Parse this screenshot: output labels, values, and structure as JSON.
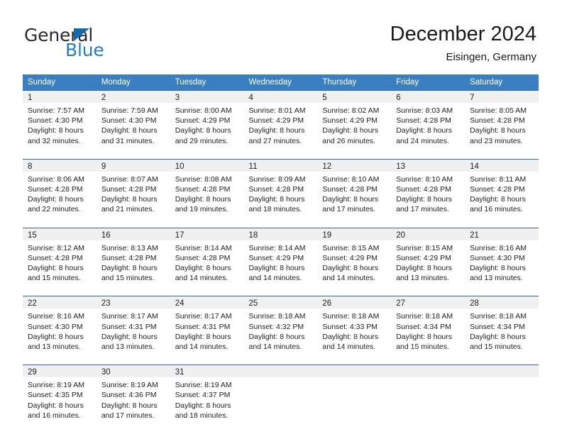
{
  "brand": {
    "name_part1": "General",
    "name_part2": "Blue",
    "triangle_color": "#1269b0",
    "blue_color": "#1f7ec4"
  },
  "header": {
    "title": "December 2024",
    "subtitle": "Eisingen, Germany"
  },
  "theme": {
    "header_row_bg": "#3a7fc1",
    "week_rule": "#2b6cab",
    "daynum_bg": "#f0f0f0",
    "text": "#222222"
  },
  "weekdays": [
    "Sunday",
    "Monday",
    "Tuesday",
    "Wednesday",
    "Thursday",
    "Friday",
    "Saturday"
  ],
  "weeks": [
    [
      {
        "day": "1",
        "sunrise": "Sunrise: 7:57 AM",
        "sunset": "Sunset: 4:30 PM",
        "daylight1": "Daylight: 8 hours",
        "daylight2": "and 32 minutes."
      },
      {
        "day": "2",
        "sunrise": "Sunrise: 7:59 AM",
        "sunset": "Sunset: 4:30 PM",
        "daylight1": "Daylight: 8 hours",
        "daylight2": "and 31 minutes."
      },
      {
        "day": "3",
        "sunrise": "Sunrise: 8:00 AM",
        "sunset": "Sunset: 4:29 PM",
        "daylight1": "Daylight: 8 hours",
        "daylight2": "and 29 minutes."
      },
      {
        "day": "4",
        "sunrise": "Sunrise: 8:01 AM",
        "sunset": "Sunset: 4:29 PM",
        "daylight1": "Daylight: 8 hours",
        "daylight2": "and 27 minutes."
      },
      {
        "day": "5",
        "sunrise": "Sunrise: 8:02 AM",
        "sunset": "Sunset: 4:29 PM",
        "daylight1": "Daylight: 8 hours",
        "daylight2": "and 26 minutes."
      },
      {
        "day": "6",
        "sunrise": "Sunrise: 8:03 AM",
        "sunset": "Sunset: 4:28 PM",
        "daylight1": "Daylight: 8 hours",
        "daylight2": "and 24 minutes."
      },
      {
        "day": "7",
        "sunrise": "Sunrise: 8:05 AM",
        "sunset": "Sunset: 4:28 PM",
        "daylight1": "Daylight: 8 hours",
        "daylight2": "and 23 minutes."
      }
    ],
    [
      {
        "day": "8",
        "sunrise": "Sunrise: 8:06 AM",
        "sunset": "Sunset: 4:28 PM",
        "daylight1": "Daylight: 8 hours",
        "daylight2": "and 22 minutes."
      },
      {
        "day": "9",
        "sunrise": "Sunrise: 8:07 AM",
        "sunset": "Sunset: 4:28 PM",
        "daylight1": "Daylight: 8 hours",
        "daylight2": "and 21 minutes."
      },
      {
        "day": "10",
        "sunrise": "Sunrise: 8:08 AM",
        "sunset": "Sunset: 4:28 PM",
        "daylight1": "Daylight: 8 hours",
        "daylight2": "and 19 minutes."
      },
      {
        "day": "11",
        "sunrise": "Sunrise: 8:09 AM",
        "sunset": "Sunset: 4:28 PM",
        "daylight1": "Daylight: 8 hours",
        "daylight2": "and 18 minutes."
      },
      {
        "day": "12",
        "sunrise": "Sunrise: 8:10 AM",
        "sunset": "Sunset: 4:28 PM",
        "daylight1": "Daylight: 8 hours",
        "daylight2": "and 17 minutes."
      },
      {
        "day": "13",
        "sunrise": "Sunrise: 8:10 AM",
        "sunset": "Sunset: 4:28 PM",
        "daylight1": "Daylight: 8 hours",
        "daylight2": "and 17 minutes."
      },
      {
        "day": "14",
        "sunrise": "Sunrise: 8:11 AM",
        "sunset": "Sunset: 4:28 PM",
        "daylight1": "Daylight: 8 hours",
        "daylight2": "and 16 minutes."
      }
    ],
    [
      {
        "day": "15",
        "sunrise": "Sunrise: 8:12 AM",
        "sunset": "Sunset: 4:28 PM",
        "daylight1": "Daylight: 8 hours",
        "daylight2": "and 15 minutes."
      },
      {
        "day": "16",
        "sunrise": "Sunrise: 8:13 AM",
        "sunset": "Sunset: 4:28 PM",
        "daylight1": "Daylight: 8 hours",
        "daylight2": "and 15 minutes."
      },
      {
        "day": "17",
        "sunrise": "Sunrise: 8:14 AM",
        "sunset": "Sunset: 4:28 PM",
        "daylight1": "Daylight: 8 hours",
        "daylight2": "and 14 minutes."
      },
      {
        "day": "18",
        "sunrise": "Sunrise: 8:14 AM",
        "sunset": "Sunset: 4:29 PM",
        "daylight1": "Daylight: 8 hours",
        "daylight2": "and 14 minutes."
      },
      {
        "day": "19",
        "sunrise": "Sunrise: 8:15 AM",
        "sunset": "Sunset: 4:29 PM",
        "daylight1": "Daylight: 8 hours",
        "daylight2": "and 14 minutes."
      },
      {
        "day": "20",
        "sunrise": "Sunrise: 8:15 AM",
        "sunset": "Sunset: 4:29 PM",
        "daylight1": "Daylight: 8 hours",
        "daylight2": "and 13 minutes."
      },
      {
        "day": "21",
        "sunrise": "Sunrise: 8:16 AM",
        "sunset": "Sunset: 4:30 PM",
        "daylight1": "Daylight: 8 hours",
        "daylight2": "and 13 minutes."
      }
    ],
    [
      {
        "day": "22",
        "sunrise": "Sunrise: 8:16 AM",
        "sunset": "Sunset: 4:30 PM",
        "daylight1": "Daylight: 8 hours",
        "daylight2": "and 13 minutes."
      },
      {
        "day": "23",
        "sunrise": "Sunrise: 8:17 AM",
        "sunset": "Sunset: 4:31 PM",
        "daylight1": "Daylight: 8 hours",
        "daylight2": "and 13 minutes."
      },
      {
        "day": "24",
        "sunrise": "Sunrise: 8:17 AM",
        "sunset": "Sunset: 4:31 PM",
        "daylight1": "Daylight: 8 hours",
        "daylight2": "and 14 minutes."
      },
      {
        "day": "25",
        "sunrise": "Sunrise: 8:18 AM",
        "sunset": "Sunset: 4:32 PM",
        "daylight1": "Daylight: 8 hours",
        "daylight2": "and 14 minutes."
      },
      {
        "day": "26",
        "sunrise": "Sunrise: 8:18 AM",
        "sunset": "Sunset: 4:33 PM",
        "daylight1": "Daylight: 8 hours",
        "daylight2": "and 14 minutes."
      },
      {
        "day": "27",
        "sunrise": "Sunrise: 8:18 AM",
        "sunset": "Sunset: 4:34 PM",
        "daylight1": "Daylight: 8 hours",
        "daylight2": "and 15 minutes."
      },
      {
        "day": "28",
        "sunrise": "Sunrise: 8:18 AM",
        "sunset": "Sunset: 4:34 PM",
        "daylight1": "Daylight: 8 hours",
        "daylight2": "and 15 minutes."
      }
    ],
    [
      {
        "day": "29",
        "sunrise": "Sunrise: 8:19 AM",
        "sunset": "Sunset: 4:35 PM",
        "daylight1": "Daylight: 8 hours",
        "daylight2": "and 16 minutes."
      },
      {
        "day": "30",
        "sunrise": "Sunrise: 8:19 AM",
        "sunset": "Sunset: 4:36 PM",
        "daylight1": "Daylight: 8 hours",
        "daylight2": "and 17 minutes."
      },
      {
        "day": "31",
        "sunrise": "Sunrise: 8:19 AM",
        "sunset": "Sunset: 4:37 PM",
        "daylight1": "Daylight: 8 hours",
        "daylight2": "and 18 minutes."
      },
      {
        "day": "",
        "sunrise": "",
        "sunset": "",
        "daylight1": "",
        "daylight2": ""
      },
      {
        "day": "",
        "sunrise": "",
        "sunset": "",
        "daylight1": "",
        "daylight2": ""
      },
      {
        "day": "",
        "sunrise": "",
        "sunset": "",
        "daylight1": "",
        "daylight2": ""
      },
      {
        "day": "",
        "sunrise": "",
        "sunset": "",
        "daylight1": "",
        "daylight2": ""
      }
    ]
  ]
}
